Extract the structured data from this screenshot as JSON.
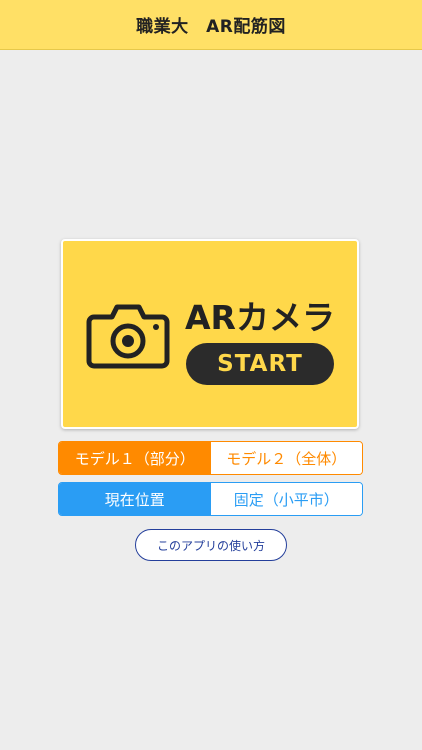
{
  "header": {
    "title": "職業大　AR配筋図"
  },
  "ar_card": {
    "icon": "camera-icon",
    "label": "ARカメラ",
    "start_label": "START",
    "colors": {
      "card": "#ffd84a",
      "pill": "#2b2b2b"
    }
  },
  "model_selector": {
    "options": [
      "モデル１（部分）",
      "モデル２（全体）"
    ],
    "selected": "モデル１（部分）",
    "color": "#ff8a00"
  },
  "location_selector": {
    "options": [
      "現在位置",
      "固定（小平市）"
    ],
    "selected": "現在位置",
    "color": "#2a9df4"
  },
  "howto_button": {
    "label": "このアプリの使い方"
  }
}
